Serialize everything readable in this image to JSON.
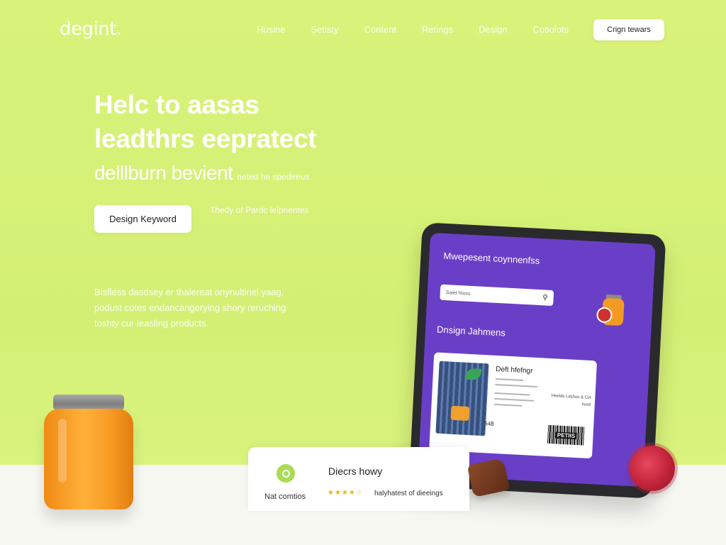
{
  "header": {
    "logo": "degint.",
    "nav": [
      "Husine",
      "Setisty",
      "Content",
      "Retings",
      "Design",
      "Cotiolots"
    ],
    "cta": "Crign tewars"
  },
  "hero": {
    "title_line1": "Helc to aasas",
    "title_line2": "leadthrs eepratect",
    "subtitle_big": "delllburn bevient",
    "subtitle_small": "neted he spedireus.",
    "button": "Design Keyword",
    "side_note": "Thedy of Pardc lelpnentes",
    "paragraph": "Bisfless dasdsey er thalereat onynultinel yaag, podust cotes endancangerying shory reruching toshty cur leasling products."
  },
  "tablet": {
    "header": "Mwepesent coynnenfss",
    "search_placeholder": "Saiet htoss",
    "section_title": "Dnsign Jahmens",
    "card": {
      "title": "Deft hfefngr",
      "price": "548",
      "barcode_label": "PETIIS",
      "side_text": "Heelds Ldshos & Ciit hord"
    }
  },
  "bottom_card": {
    "title": "Diecrs howy",
    "left_label": "Nat comtios",
    "rating_stars": 4.5,
    "right_label": "halyhatest of dieeings"
  },
  "colors": {
    "background": "#d6f177",
    "accent_purple": "#6a3fc8",
    "jar_orange": "#f79a22",
    "star": "#f4b400",
    "badge_green": "#a9dc52"
  },
  "icons": {
    "search": "search-icon",
    "clock": "clock-icon"
  }
}
